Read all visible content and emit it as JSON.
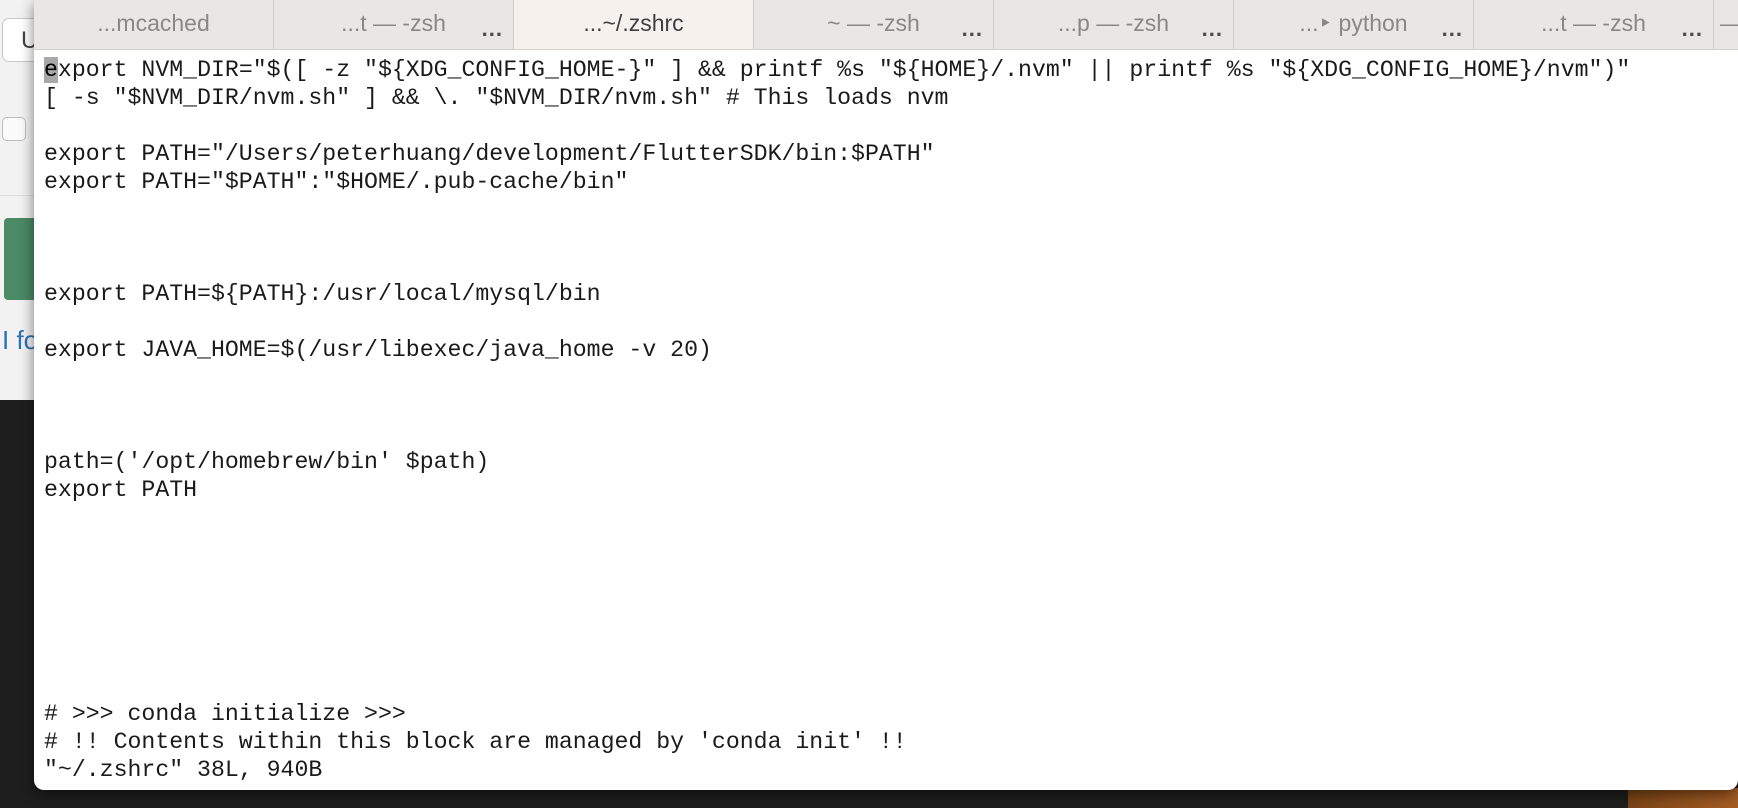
{
  "background_app": {
    "field_text": "U",
    "link_text": "I fo"
  },
  "tabs": [
    {
      "label": "...mcached",
      "more": ""
    },
    {
      "label": "...t — -zsh",
      "more": "..."
    },
    {
      "label": "...~/.zshrc",
      "more": ""
    },
    {
      "label": "~ — -zsh",
      "more": "..."
    },
    {
      "label": "...p — -zsh",
      "more": "..."
    },
    {
      "label": "...‣ python",
      "more": "..."
    },
    {
      "label": "...t — -zsh",
      "more": "..."
    },
    {
      "label": "— -zs",
      "more": ""
    }
  ],
  "editor": {
    "cursor_char": "e",
    "lines": [
      "xport NVM_DIR=\"$([ -z \"${XDG_CONFIG_HOME-}\" ] && printf %s \"${HOME}/.nvm\" || printf %s \"${XDG_CONFIG_HOME}/nvm\")\"",
      "[ -s \"$NVM_DIR/nvm.sh\" ] && \\. \"$NVM_DIR/nvm.sh\" # This loads nvm",
      "",
      "export PATH=\"/Users/peterhuang/development/FlutterSDK/bin:$PATH\"",
      "export PATH=\"$PATH\":\"$HOME/.pub-cache/bin\"",
      "",
      "",
      "",
      "export PATH=${PATH}:/usr/local/mysql/bin",
      "",
      "export JAVA_HOME=$(/usr/libexec/java_home -v 20)",
      "",
      "",
      "",
      "path=('/opt/homebrew/bin' $path)",
      "export PATH",
      "",
      "",
      "",
      "",
      "",
      "",
      "",
      "# >>> conda initialize >>>",
      "# !! Contents within this block are managed by 'conda init' !!",
      "\"~/.zshrc\" 38L, 940B"
    ]
  }
}
